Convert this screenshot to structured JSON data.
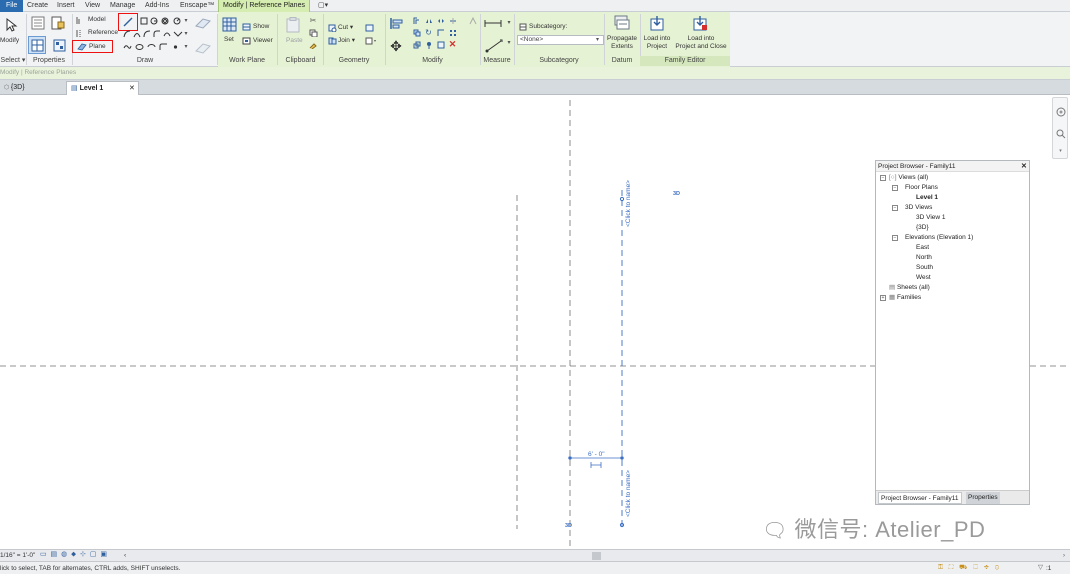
{
  "menubar": {
    "file": "File",
    "tabs": [
      "Create",
      "Insert",
      "View",
      "Manage",
      "Add-Ins",
      "Enscape™"
    ],
    "context_tab": "Modify | Reference Planes",
    "extra_tab": "▢▾"
  },
  "ribbon": {
    "groups": {
      "select": "Select ▾",
      "properties": "Properties",
      "draw": "Draw",
      "work_plane": "Work Plane",
      "clipboard": "Clipboard",
      "geometry": "Geometry",
      "modify": "Modify",
      "measure": "Measure",
      "subcategory": "Subcategory",
      "datum": "Datum",
      "family_editor": "Family Editor"
    },
    "modify_label": "Modify",
    "model_label": "Model",
    "reference_label": "Reference",
    "plane_label": "Plane",
    "set_label": "Set",
    "show_label": "Show",
    "viewer_label": "Viewer",
    "paste_label": "Paste",
    "cut_label": "Cut ▾",
    "join_label": "Join ▾",
    "subcategory_label": "Subcategory:",
    "subcategory_value": "<None>",
    "propagate_label": "Propagate\nExtents",
    "load_into_project": "Load into\nProject",
    "load_into_project_close": "Load into\nProject and Close"
  },
  "context_bar": "Modify | Reference Planes",
  "view_tabs": {
    "tab_3d": "{3D}",
    "tab_level1": "Level 1",
    "close": "✕"
  },
  "canvas": {
    "label_click_to_name_top": "<Click to name>",
    "label_click_to_name_bottom": "<Click to name>",
    "dimension": "6' - 0\"",
    "tag_3d_top": "3D",
    "tag_3d_bottom": "3D"
  },
  "project_browser": {
    "title": "Project Browser - Family11",
    "close": "✕",
    "nodes": {
      "views": "Views (all)",
      "floor_plans": "Floor Plans",
      "level1": "Level 1",
      "views_3d": "3D Views",
      "view_3d_1": "3D View 1",
      "view_3d": "{3D}",
      "elevations": "Elevations (Elevation 1)",
      "east": "East",
      "north": "North",
      "south": "South",
      "west": "West",
      "sheets": "Sheets (all)",
      "families": "Families"
    },
    "footer_tabs": [
      "Project Browser - Family11",
      "Properties"
    ]
  },
  "view_control_bar": {
    "scale": "1/16\" = 1'-0\"",
    "chevron": "‹"
  },
  "status_bar": {
    "message": "lick to select, TAB for alternates, CTRL adds, SHIFT unselects.",
    "filter_count": ":1"
  },
  "watermark": {
    "text": "微信号: Atelier_PD"
  },
  "colors": {
    "file_tab": "#2b6cb0",
    "context_tab": "#d5edb0",
    "highlight_box": "#e11111",
    "reference_plane": "#3c6fc4",
    "hidden_line": "#707070"
  }
}
